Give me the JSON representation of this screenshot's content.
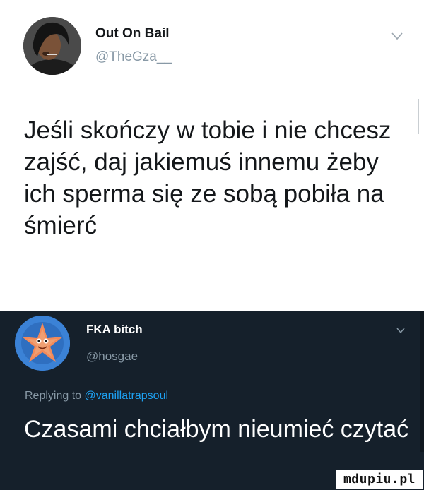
{
  "tweet_1": {
    "display_name": "Out On Bail",
    "handle": "@TheGza__",
    "text": "Jeśli skończy w tobie i nie chcesz zajść, daj jakiemuś innemu żeby ich sperma się ze sobą pobiła na śmierć",
    "theme": "light"
  },
  "tweet_2": {
    "display_name": "FKA bitch",
    "handle": "@hosgae",
    "replying_prefix": "Replying to",
    "replying_mention": "@vanillatrapsoul",
    "text": "Czasami chciałbym nieumieć czytać",
    "theme": "dark"
  },
  "watermark": "mdupiu.pl",
  "colors": {
    "light_bg": "#ffffff",
    "dark_bg": "#15202b",
    "muted": "#8899a6",
    "link": "#1da1f2"
  },
  "icons": {
    "tweet_1_menu": "chevron-down-icon",
    "tweet_2_menu": "chevron-down-icon",
    "tweet_2_avatar": "starfish-avatar"
  }
}
